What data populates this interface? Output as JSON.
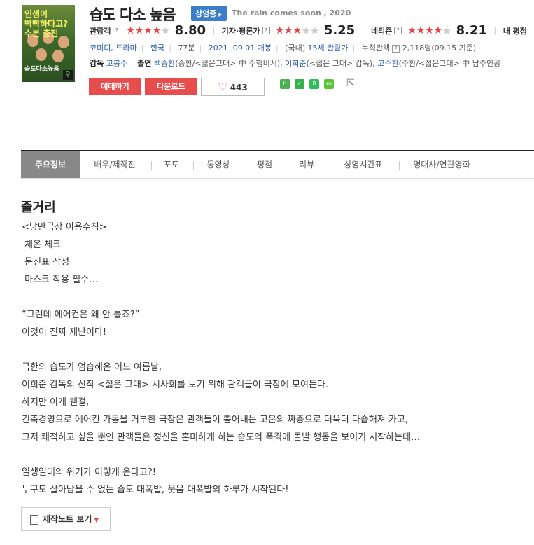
{
  "movie": {
    "poster_title": "인생이\n빡빡하다고?\n수분 충전",
    "poster_logo": "습도다소높음",
    "title": "습도 다소 높음",
    "status_badge": "상영중",
    "eng_title": "The rain comes soon , 2020"
  },
  "ratings": {
    "audience_label": "관람객",
    "audience_score": "8.80",
    "critic_label": "기자·평론가",
    "critic_score": "5.25",
    "netizen_label": "네티즌",
    "netizen_score": "8.21",
    "my_label": "내 평점"
  },
  "info": {
    "genre": "코미디, 드라마",
    "country": "한국",
    "runtime": "77분",
    "release": "2021 .09.01 개봉",
    "rating_prefix": "[국내]",
    "rating": "15세 관람가",
    "cumulative_label": "누적관객",
    "cumulative": "2,118명",
    "cumulative_date": "(09.15 기준)"
  },
  "credits": {
    "director_label": "감독",
    "director": "고봉수",
    "cast_label": "출연",
    "cast_1": "백승환",
    "cast_1_role": "(승환/<젊은그대> 中 수행비서),",
    "cast_2": "이희준",
    "cast_2_role": "(<젊은 그대> 감독),",
    "cast_3": "고주환",
    "cast_3_role": "(주환/<젊은그대> 中 남주인공"
  },
  "buttons": {
    "reserve": "예매하기",
    "download": "다운로드",
    "like_count": "443"
  },
  "tabs": [
    "주요정보",
    "배우/제작진",
    "포토",
    "동영상",
    "평점",
    "리뷰",
    "상영시간표",
    "명대사/연관영화"
  ],
  "section_title": "줄거리",
  "plot": "<낭만극장 이용수칙>\n 체온 체크\n 문진표 작성\n 마스크 착용 필수…\n\n“그런데 에어컨은 왜 안 틀죠?”\n이것이 진짜 재난이다!\n\n극한의 습도가 엄습해온 어느 여름날,\n이희준 감독의 신작 <젊은 그대> 시사회를 보기 위해 관객들이 극장에 모여든다.\n하지만 이게 웬걸,\n긴축경영으로 에어컨 가동을 거부한 극장은 관객들이 뿜어내는 고온의 짜증으로 더욱더 다습해져 가고,\n그저 쾌적하고 싶을 뿐인 관객들은 정신을 혼미하게 하는 습도의 폭격에 돌발 행동을 보이기 시작하는데…\n\n일생일대의 위기가 이렇게 온다고?!\n누구도 살아남을 수 없는 습도 대폭발, 웃음 대폭발의 하루가 시작된다!",
  "note_button": "제작노트 보기",
  "colors": {
    "accent_red": "#e84d4d",
    "badge_blue": "#3b7dc8",
    "link_blue": "#2a5ea8"
  }
}
